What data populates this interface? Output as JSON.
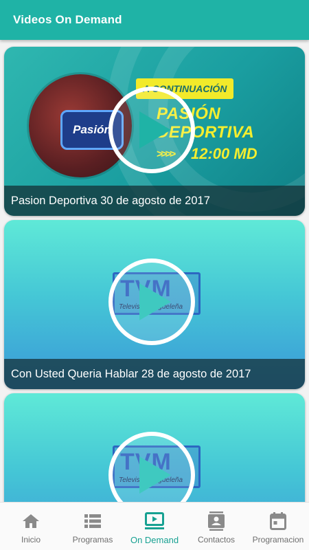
{
  "app": {
    "title": "Videos On Demand"
  },
  "videos": [
    {
      "caption": "Pasion Deportiva 30 de agosto de 2017",
      "thumb": {
        "badge": "A CONTINUACIÓN",
        "show_line1": "PASIÓN",
        "show_line2": "DEPORTIVA",
        "arrows": ">>>>",
        "time": "12:00 MD",
        "logo": "Pasión"
      }
    },
    {
      "caption": "Con Usted Queria Hablar 28 de agosto de 2017",
      "thumb": {
        "logo": "TVM",
        "logo_sub": "Televisión Migueleña"
      }
    },
    {
      "caption": "",
      "thumb": {
        "logo": "TVM",
        "logo_sub": "Televisión Migueleña"
      }
    }
  ],
  "nav": {
    "items": [
      {
        "label": "Inicio",
        "icon": "home-icon"
      },
      {
        "label": "Programas",
        "icon": "list-icon"
      },
      {
        "label": "On Demand",
        "icon": "video-icon",
        "active": true
      },
      {
        "label": "Contactos",
        "icon": "contacts-icon"
      },
      {
        "label": "Programacion",
        "icon": "calendar-icon"
      }
    ]
  },
  "colors": {
    "primary": "#1fb3a6",
    "active": "#17a192",
    "inactive": "#8a8a8a"
  }
}
